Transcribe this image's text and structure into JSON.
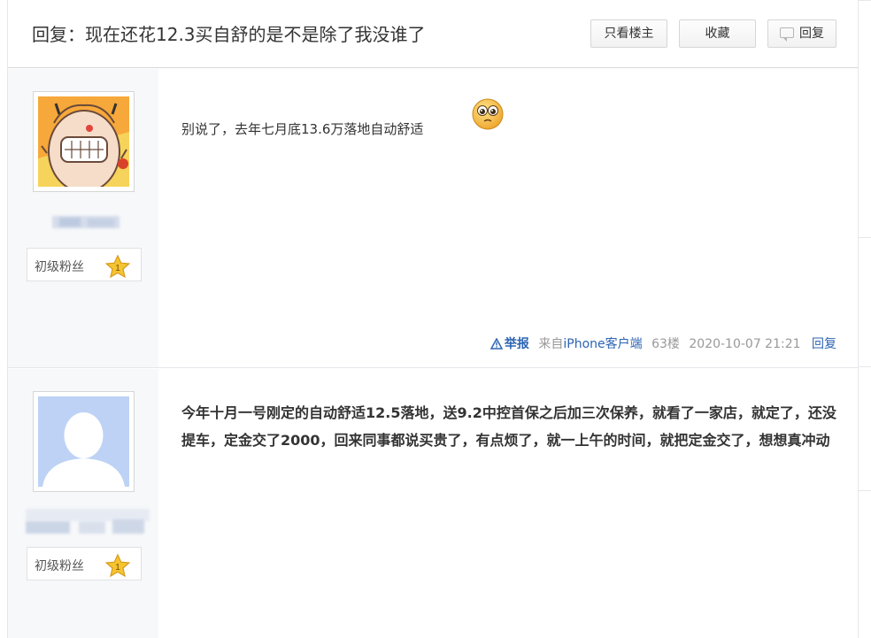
{
  "thread": {
    "title": "回复：现在还花12.3买自舒的是不是除了我没谁了",
    "only_owner_label": "只看楼主",
    "favorite_label": "收藏",
    "reply_label": "回复"
  },
  "posts": [
    {
      "level": "初级粉丝",
      "level_num": "1",
      "content": "别说了，去年七月底13.6万落地自动舒适",
      "meta": {
        "report": "举报",
        "source_prefix": "来自",
        "source_link": "iPhone客户端",
        "floor": "63楼",
        "time": "2020-10-07 21:21",
        "reply": "回复"
      }
    },
    {
      "level": "初级粉丝",
      "level_num": "1",
      "content": "今年十月一号刚定的自动舒适12.5落地，送9.2中控首保之后加三次保养，就看了一家店，就定了，还没提车，定金交了2000，回来同事都说买贵了，有点烦了，就一上午的时间，就把定金交了，想想真冲动"
    }
  ],
  "colors": {
    "link": "#2d64b3",
    "author_bg": "#f7f8fa",
    "star": "#f5c431"
  }
}
